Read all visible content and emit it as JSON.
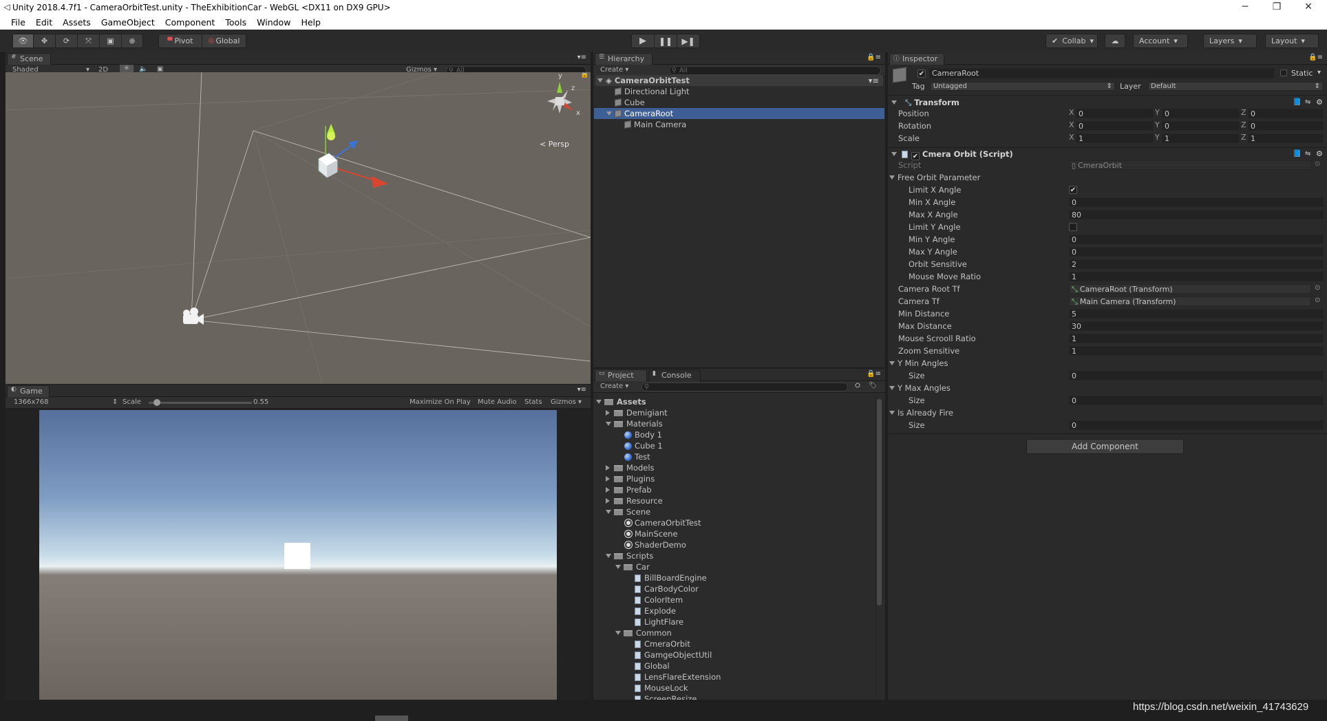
{
  "window": {
    "title": "Unity 2018.4.7f1 - CameraOrbitTest.unity - TheExhibitionCar - WebGL <DX11 on DX9 GPU>",
    "minimize": "─",
    "maximize": "❐",
    "close": "✕"
  },
  "menu": [
    "File",
    "Edit",
    "Assets",
    "GameObject",
    "Component",
    "Tools",
    "Window",
    "Help"
  ],
  "toolbar": {
    "pivot": "Pivot",
    "global": "Global",
    "collab": "Collab",
    "account": "Account",
    "layers": "Layers",
    "layout": "Layout"
  },
  "scene": {
    "tab": "Scene",
    "shading": "Shaded",
    "mode_2d": "2D",
    "gizmos": "Gizmos",
    "search_placeholder": "All",
    "persp": "Persp",
    "gizmo_axes": {
      "y": "y",
      "z": "z",
      "x": "x"
    }
  },
  "game": {
    "tab": "Game",
    "resolution": "1366x768",
    "scale_label": "Scale",
    "scale_value": "0.55",
    "scale_fraction": 0.05,
    "maximize_on_play": "Maximize On Play",
    "mute_audio": "Mute Audio",
    "stats": "Stats",
    "gizmos": "Gizmos"
  },
  "hierarchy": {
    "tab": "Hierarchy",
    "create": "Create",
    "search_placeholder": "All",
    "scene_name": "CameraOrbitTest",
    "items": [
      {
        "label": "Directional Light"
      },
      {
        "label": "Cube"
      },
      {
        "label": "CameraRoot"
      },
      {
        "label": "Main Camera"
      }
    ]
  },
  "project": {
    "tab": "Project",
    "console_tab": "Console",
    "create": "Create",
    "root": "Assets",
    "items": [
      {
        "label": "Demigiant"
      },
      {
        "label": "Materials"
      },
      {
        "label": "Body 1"
      },
      {
        "label": "Cube 1"
      },
      {
        "label": "Test"
      },
      {
        "label": "Models"
      },
      {
        "label": "Plugins"
      },
      {
        "label": "Prefab"
      },
      {
        "label": "Resource"
      },
      {
        "label": "Scene"
      },
      {
        "label": "CameraOrbitTest"
      },
      {
        "label": "MainScene"
      },
      {
        "label": "ShaderDemo"
      },
      {
        "label": "Scripts"
      },
      {
        "label": "Car"
      },
      {
        "label": "BillBoardEngine"
      },
      {
        "label": "CarBodyColor"
      },
      {
        "label": "ColorItem"
      },
      {
        "label": "Explode"
      },
      {
        "label": "LightFlare"
      },
      {
        "label": "Common"
      },
      {
        "label": "CmeraOrbit"
      },
      {
        "label": "GamgeObjectUtil"
      },
      {
        "label": "Global"
      },
      {
        "label": "LensFlareExtension"
      },
      {
        "label": "MouseLock"
      },
      {
        "label": "ScreenResize"
      }
    ]
  },
  "inspector": {
    "tab": "Inspector",
    "object_name": "CameraRoot",
    "static_label": "Static",
    "tag_label": "Tag",
    "tag_value": "Untagged",
    "layer_label": "Layer",
    "layer_value": "Default",
    "transform": {
      "title": "Transform",
      "rows": [
        {
          "label": "Position",
          "x": "0",
          "y": "0",
          "z": "0"
        },
        {
          "label": "Rotation",
          "x": "0",
          "y": "0",
          "z": "0"
        },
        {
          "label": "Scale",
          "x": "1",
          "y": "1",
          "z": "1"
        }
      ],
      "axis_x": "X",
      "axis_y": "Y",
      "axis_z": "Z"
    },
    "script_component": {
      "title": "Cmera Orbit (Script)",
      "script_label": "Script",
      "script_value": "CmeraOrbit",
      "free_orbit": "Free Orbit Parameter",
      "limit_x_angle": "Limit X Angle",
      "min_x_angle": {
        "label": "Min X Angle",
        "value": "0"
      },
      "max_x_angle": {
        "label": "Max X Angle",
        "value": "80"
      },
      "limit_y_angle": "Limit Y Angle",
      "min_y_angle": {
        "label": "Min Y Angle",
        "value": "0"
      },
      "max_y_angle": {
        "label": "Max Y Angle",
        "value": "0"
      },
      "orbit_sensitive": {
        "label": "Orbit Sensitive",
        "value": "2"
      },
      "mouse_move_ratio": {
        "label": "Mouse Move Ratio",
        "value": "1"
      },
      "camera_root_tf": {
        "label": "Camera Root Tf",
        "value": "CameraRoot (Transform)"
      },
      "camera_tf": {
        "label": "Camera Tf",
        "value": "Main Camera (Transform)"
      },
      "min_distance": {
        "label": "Min Distance",
        "value": "5"
      },
      "max_distance": {
        "label": "Max Distance",
        "value": "30"
      },
      "mouse_scroll_ratio": {
        "label": "Mouse Scrooll Ratio",
        "value": "1"
      },
      "zoom_sensitive": {
        "label": "Zoom Sensitive",
        "value": "1"
      },
      "y_min_angles": "Y Min Angles",
      "y_max_angles": "Y Max Angles",
      "is_already_fire": "Is Already Fire",
      "size_label": "Size",
      "size_value": "0"
    },
    "add_component": "Add Component"
  },
  "watermark": "https://blog.csdn.net/weixin_41743629",
  "colors": {
    "selection": "#3e5f96",
    "sky_top": "#5a7aa8",
    "horizon": "#dfe9ee",
    "ground": "#6c645e"
  }
}
